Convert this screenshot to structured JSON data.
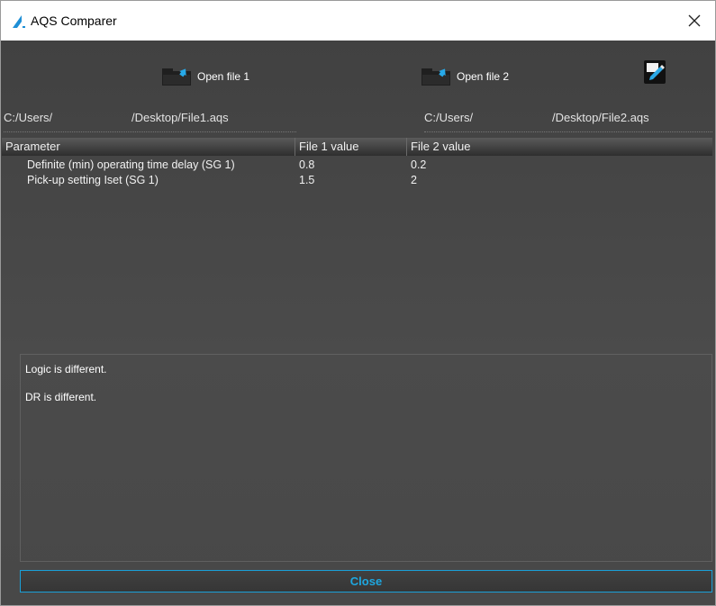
{
  "window": {
    "title": "AQS Comparer",
    "close_glyph": "✕"
  },
  "toolbar": {
    "open_file_1_label": "Open file 1",
    "open_file_2_label": "Open file 2",
    "icons": [
      "open-folder-icon",
      "open-folder-icon",
      "report-edit-icon"
    ]
  },
  "paths": {
    "file1_prefix": "C:/Users/",
    "file1_suffix": "/Desktop/File1.aqs",
    "file2_prefix": "C:/Users/",
    "file2_suffix": "/Desktop/File2.aqs"
  },
  "table": {
    "headers": [
      "Parameter",
      "File 1 value",
      "File 2 value"
    ],
    "rows": [
      {
        "parameter": "Definite (min) operating time delay (SG 1)",
        "file1": "0.8",
        "file2": "0.2"
      },
      {
        "parameter": "Pick-up setting Iset (SG 1)",
        "file1": "1.5",
        "file2": "2"
      }
    ]
  },
  "messages": [
    "Logic is different.",
    "DR is different."
  ],
  "footer": {
    "close_label": "Close"
  },
  "colors": {
    "accent": "#1ea7e0",
    "background": "#4a4a4a"
  }
}
